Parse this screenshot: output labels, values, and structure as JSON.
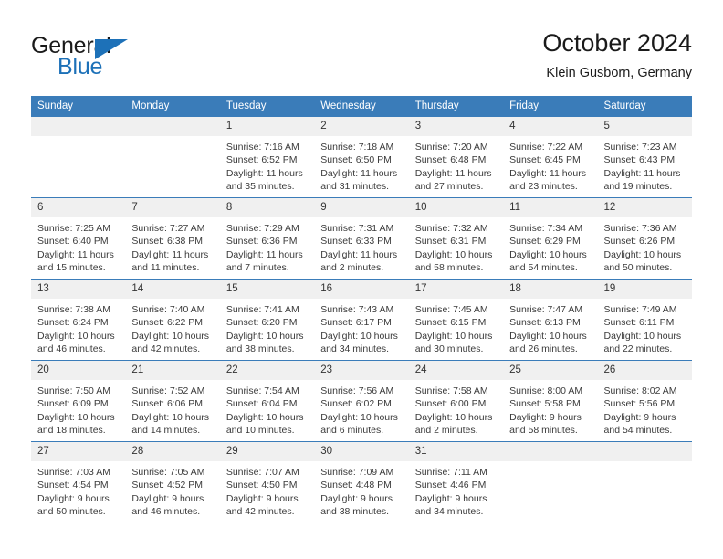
{
  "brand": {
    "name_top": "General",
    "name_bottom": "Blue",
    "accent_color": "#1d71b8"
  },
  "header": {
    "title": "October 2024",
    "subtitle": "Klein Gusborn, Germany",
    "header_bg": "#3a7cb9",
    "daynum_bg": "#f0f0f0"
  },
  "weekday_headers": [
    "Sunday",
    "Monday",
    "Tuesday",
    "Wednesday",
    "Thursday",
    "Friday",
    "Saturday"
  ],
  "labels": {
    "sunrise_prefix": "Sunrise:",
    "sunset_prefix": "Sunset:",
    "daylight_prefix": "Daylight:"
  },
  "weeks": [
    [
      {
        "day": "",
        "sunrise": "",
        "sunset": "",
        "daylight": "",
        "empty": true
      },
      {
        "day": "",
        "sunrise": "",
        "sunset": "",
        "daylight": "",
        "empty": true
      },
      {
        "day": "1",
        "sunrise": "Sunrise: 7:16 AM",
        "sunset": "Sunset: 6:52 PM",
        "daylight": "Daylight: 11 hours and 35 minutes."
      },
      {
        "day": "2",
        "sunrise": "Sunrise: 7:18 AM",
        "sunset": "Sunset: 6:50 PM",
        "daylight": "Daylight: 11 hours and 31 minutes."
      },
      {
        "day": "3",
        "sunrise": "Sunrise: 7:20 AM",
        "sunset": "Sunset: 6:48 PM",
        "daylight": "Daylight: 11 hours and 27 minutes."
      },
      {
        "day": "4",
        "sunrise": "Sunrise: 7:22 AM",
        "sunset": "Sunset: 6:45 PM",
        "daylight": "Daylight: 11 hours and 23 minutes."
      },
      {
        "day": "5",
        "sunrise": "Sunrise: 7:23 AM",
        "sunset": "Sunset: 6:43 PM",
        "daylight": "Daylight: 11 hours and 19 minutes."
      }
    ],
    [
      {
        "day": "6",
        "sunrise": "Sunrise: 7:25 AM",
        "sunset": "Sunset: 6:40 PM",
        "daylight": "Daylight: 11 hours and 15 minutes."
      },
      {
        "day": "7",
        "sunrise": "Sunrise: 7:27 AM",
        "sunset": "Sunset: 6:38 PM",
        "daylight": "Daylight: 11 hours and 11 minutes."
      },
      {
        "day": "8",
        "sunrise": "Sunrise: 7:29 AM",
        "sunset": "Sunset: 6:36 PM",
        "daylight": "Daylight: 11 hours and 7 minutes."
      },
      {
        "day": "9",
        "sunrise": "Sunrise: 7:31 AM",
        "sunset": "Sunset: 6:33 PM",
        "daylight": "Daylight: 11 hours and 2 minutes."
      },
      {
        "day": "10",
        "sunrise": "Sunrise: 7:32 AM",
        "sunset": "Sunset: 6:31 PM",
        "daylight": "Daylight: 10 hours and 58 minutes."
      },
      {
        "day": "11",
        "sunrise": "Sunrise: 7:34 AM",
        "sunset": "Sunset: 6:29 PM",
        "daylight": "Daylight: 10 hours and 54 minutes."
      },
      {
        "day": "12",
        "sunrise": "Sunrise: 7:36 AM",
        "sunset": "Sunset: 6:26 PM",
        "daylight": "Daylight: 10 hours and 50 minutes."
      }
    ],
    [
      {
        "day": "13",
        "sunrise": "Sunrise: 7:38 AM",
        "sunset": "Sunset: 6:24 PM",
        "daylight": "Daylight: 10 hours and 46 minutes."
      },
      {
        "day": "14",
        "sunrise": "Sunrise: 7:40 AM",
        "sunset": "Sunset: 6:22 PM",
        "daylight": "Daylight: 10 hours and 42 minutes."
      },
      {
        "day": "15",
        "sunrise": "Sunrise: 7:41 AM",
        "sunset": "Sunset: 6:20 PM",
        "daylight": "Daylight: 10 hours and 38 minutes."
      },
      {
        "day": "16",
        "sunrise": "Sunrise: 7:43 AM",
        "sunset": "Sunset: 6:17 PM",
        "daylight": "Daylight: 10 hours and 34 minutes."
      },
      {
        "day": "17",
        "sunrise": "Sunrise: 7:45 AM",
        "sunset": "Sunset: 6:15 PM",
        "daylight": "Daylight: 10 hours and 30 minutes."
      },
      {
        "day": "18",
        "sunrise": "Sunrise: 7:47 AM",
        "sunset": "Sunset: 6:13 PM",
        "daylight": "Daylight: 10 hours and 26 minutes."
      },
      {
        "day": "19",
        "sunrise": "Sunrise: 7:49 AM",
        "sunset": "Sunset: 6:11 PM",
        "daylight": "Daylight: 10 hours and 22 minutes."
      }
    ],
    [
      {
        "day": "20",
        "sunrise": "Sunrise: 7:50 AM",
        "sunset": "Sunset: 6:09 PM",
        "daylight": "Daylight: 10 hours and 18 minutes."
      },
      {
        "day": "21",
        "sunrise": "Sunrise: 7:52 AM",
        "sunset": "Sunset: 6:06 PM",
        "daylight": "Daylight: 10 hours and 14 minutes."
      },
      {
        "day": "22",
        "sunrise": "Sunrise: 7:54 AM",
        "sunset": "Sunset: 6:04 PM",
        "daylight": "Daylight: 10 hours and 10 minutes."
      },
      {
        "day": "23",
        "sunrise": "Sunrise: 7:56 AM",
        "sunset": "Sunset: 6:02 PM",
        "daylight": "Daylight: 10 hours and 6 minutes."
      },
      {
        "day": "24",
        "sunrise": "Sunrise: 7:58 AM",
        "sunset": "Sunset: 6:00 PM",
        "daylight": "Daylight: 10 hours and 2 minutes."
      },
      {
        "day": "25",
        "sunrise": "Sunrise: 8:00 AM",
        "sunset": "Sunset: 5:58 PM",
        "daylight": "Daylight: 9 hours and 58 minutes."
      },
      {
        "day": "26",
        "sunrise": "Sunrise: 8:02 AM",
        "sunset": "Sunset: 5:56 PM",
        "daylight": "Daylight: 9 hours and 54 minutes."
      }
    ],
    [
      {
        "day": "27",
        "sunrise": "Sunrise: 7:03 AM",
        "sunset": "Sunset: 4:54 PM",
        "daylight": "Daylight: 9 hours and 50 minutes."
      },
      {
        "day": "28",
        "sunrise": "Sunrise: 7:05 AM",
        "sunset": "Sunset: 4:52 PM",
        "daylight": "Daylight: 9 hours and 46 minutes."
      },
      {
        "day": "29",
        "sunrise": "Sunrise: 7:07 AM",
        "sunset": "Sunset: 4:50 PM",
        "daylight": "Daylight: 9 hours and 42 minutes."
      },
      {
        "day": "30",
        "sunrise": "Sunrise: 7:09 AM",
        "sunset": "Sunset: 4:48 PM",
        "daylight": "Daylight: 9 hours and 38 minutes."
      },
      {
        "day": "31",
        "sunrise": "Sunrise: 7:11 AM",
        "sunset": "Sunset: 4:46 PM",
        "daylight": "Daylight: 9 hours and 34 minutes."
      },
      {
        "day": "",
        "sunrise": "",
        "sunset": "",
        "daylight": "",
        "empty": true
      },
      {
        "day": "",
        "sunrise": "",
        "sunset": "",
        "daylight": "",
        "empty": true
      }
    ]
  ]
}
